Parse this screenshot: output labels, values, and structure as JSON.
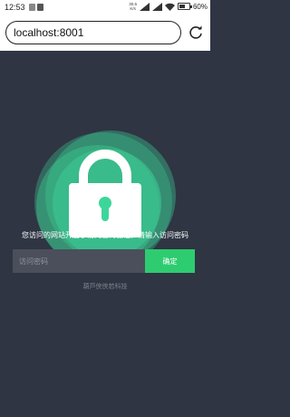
{
  "status_bar": {
    "time": "12:53",
    "net_speed_value": "30.6",
    "net_speed_unit": "K/s",
    "battery_text": "60%",
    "battery_level": 0.6
  },
  "browser": {
    "url": "localhost:8001"
  },
  "page": {
    "message": "您访问的网站开启了访问密码验证，请输入访问密码",
    "password_placeholder": "访问密码",
    "confirm_label": "确定",
    "footer": "葫芦侠侠若科技"
  },
  "colors": {
    "background": "#2f3542",
    "accent_green": "#2ecc71",
    "blob_green": "#3dd69a"
  }
}
